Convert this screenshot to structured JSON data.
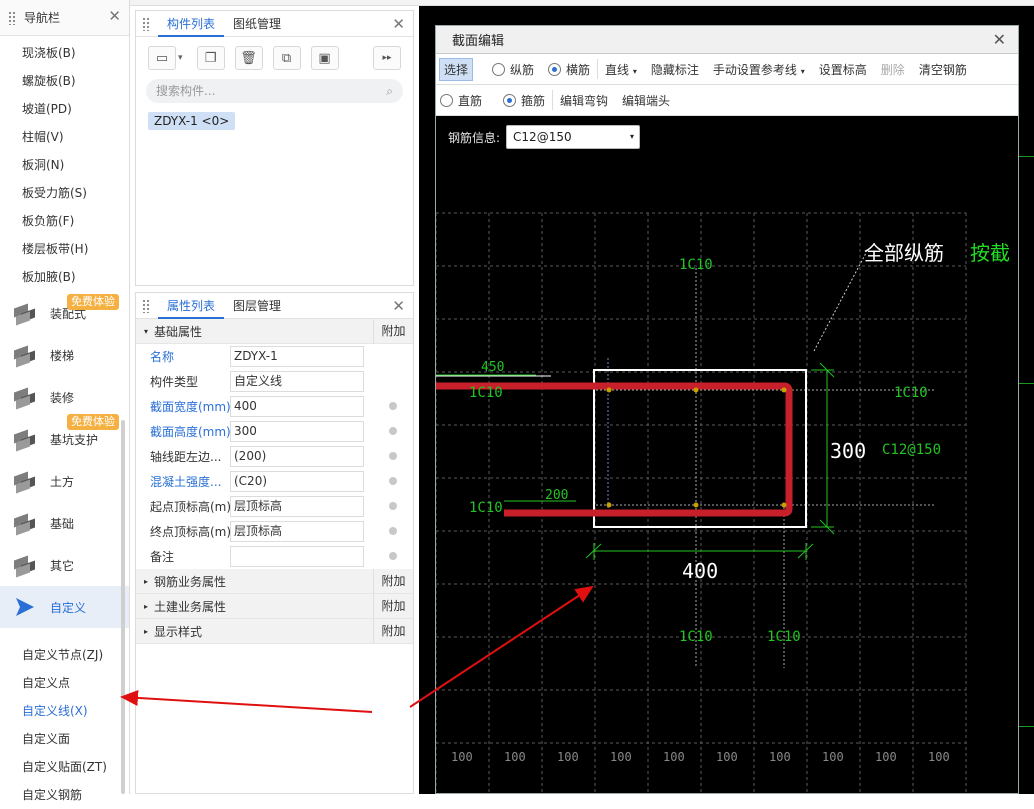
{
  "top_strip_title": "",
  "nav": {
    "title": "导航栏",
    "subitems_top": [
      "现浇板(B)",
      "螺旋板(B)",
      "坡道(PD)",
      "柱帽(V)",
      "板洞(N)",
      "板受力筋(S)",
      "板负筋(F)",
      "楼层板带(H)",
      "板加腋(B)"
    ],
    "categories": [
      {
        "label": "装配式",
        "badge": "免费体验"
      },
      {
        "label": "楼梯"
      },
      {
        "label": "装修"
      },
      {
        "label": "基坑支护",
        "badge": "免费体验"
      },
      {
        "label": "土方"
      },
      {
        "label": "基础"
      },
      {
        "label": "其它"
      },
      {
        "label": "自定义"
      }
    ],
    "subitems_bottom": [
      "自定义节点(ZJ)",
      "自定义点",
      "自定义线(X)",
      "自定义面",
      "自定义贴面(ZT)",
      "自定义钢筋"
    ]
  },
  "component_panel": {
    "tabs": [
      "构件列表",
      "图纸管理"
    ],
    "search_placeholder": "搜索构件...",
    "item": "ZDYX-1 <0>"
  },
  "property_panel": {
    "tabs": [
      "属性列表",
      "图层管理"
    ],
    "group_basic": "基础属性",
    "add_label": "附加",
    "rows": [
      {
        "name": "名称",
        "value": "ZDYX-1",
        "blue": true,
        "dot": false
      },
      {
        "name": "构件类型",
        "value": "自定义线",
        "blue": false,
        "dot": false
      },
      {
        "name": "截面宽度(mm)",
        "value": "400",
        "blue": true,
        "dot": true
      },
      {
        "name": "截面高度(mm)",
        "value": "300",
        "blue": true,
        "dot": true
      },
      {
        "name": "轴线距左边...",
        "value": "(200)",
        "blue": false,
        "dot": true
      },
      {
        "name": "混凝土强度...",
        "value": "(C20)",
        "blue": true,
        "dot": true
      },
      {
        "name": "起点顶标高(m)",
        "value": "层顶标高",
        "blue": false,
        "dot": true
      },
      {
        "name": "终点顶标高(m)",
        "value": "层顶标高",
        "blue": false,
        "dot": true
      },
      {
        "name": "备注",
        "value": "",
        "blue": false,
        "dot": true
      }
    ],
    "groups_collapsed": [
      "钢筋业务属性",
      "土建业务属性",
      "显示样式"
    ]
  },
  "dialog": {
    "title": "截面编辑",
    "toolbar1": {
      "select": "选择",
      "radio_long": "纵筋",
      "radio_trans": "横筋",
      "line": "直线",
      "hide_label": "隐藏标注",
      "manual_ref": "手动设置参考线",
      "set_elev": "设置标高",
      "delete": "删除",
      "clear": "清空钢筋"
    },
    "toolbar2": {
      "radio_straight": "直筋",
      "radio_stirrup": "箍筋",
      "edit_hook": "编辑弯钩",
      "edit_end": "编辑端头"
    },
    "rebar_info_label": "钢筋信息:",
    "rebar_info_value": "C12@150",
    "canvas": {
      "all_long_label": "全部纵筋",
      "press_label": "按截",
      "top_bar": "1C10",
      "left_top_bar": "1C10",
      "left_bottom_bar": "1C10",
      "right_bar": "1C10",
      "bottom_bar1": "1C10",
      "bottom_bar2": "1C10",
      "stirrup_label": "C12@150",
      "dim_450": "450",
      "dim_200": "200",
      "dim_300": "300",
      "dim_400": "400",
      "grid_label": "100"
    }
  },
  "colors": {
    "accent": "#2a6fd6",
    "rebar": "#c8202a",
    "dim_green": "#22c322",
    "arrow": "#e01010"
  }
}
